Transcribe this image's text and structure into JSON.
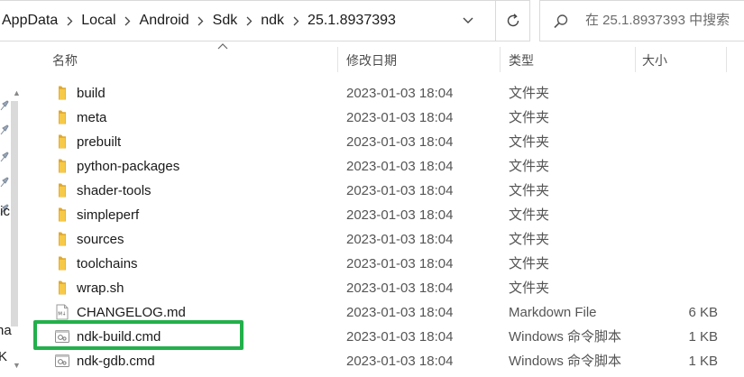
{
  "address": {
    "breadcrumb": [
      "AppData",
      "Local",
      "Android",
      "Sdk",
      "ndk",
      "25.1.8937393"
    ],
    "dropdown_icon": "chevron-down-icon",
    "refresh_icon": "refresh-icon"
  },
  "search": {
    "placeholder": "在 25.1.8937393 中搜索",
    "icon": "search-icon"
  },
  "nav": {
    "fragments": [
      "tic",
      "na",
      "K"
    ]
  },
  "columns": {
    "name": "名称",
    "date": "修改日期",
    "type": "类型",
    "size": "大小"
  },
  "files": [
    {
      "name": "build",
      "date": "2023-01-03 18:04",
      "type": "文件夹",
      "size": "",
      "icon": "folder-icon"
    },
    {
      "name": "meta",
      "date": "2023-01-03 18:04",
      "type": "文件夹",
      "size": "",
      "icon": "folder-icon"
    },
    {
      "name": "prebuilt",
      "date": "2023-01-03 18:04",
      "type": "文件夹",
      "size": "",
      "icon": "folder-icon"
    },
    {
      "name": "python-packages",
      "date": "2023-01-03 18:04",
      "type": "文件夹",
      "size": "",
      "icon": "folder-icon"
    },
    {
      "name": "shader-tools",
      "date": "2023-01-03 18:04",
      "type": "文件夹",
      "size": "",
      "icon": "folder-icon"
    },
    {
      "name": "simpleperf",
      "date": "2023-01-03 18:04",
      "type": "文件夹",
      "size": "",
      "icon": "folder-icon"
    },
    {
      "name": "sources",
      "date": "2023-01-03 18:04",
      "type": "文件夹",
      "size": "",
      "icon": "folder-icon"
    },
    {
      "name": "toolchains",
      "date": "2023-01-03 18:04",
      "type": "文件夹",
      "size": "",
      "icon": "folder-icon"
    },
    {
      "name": "wrap.sh",
      "date": "2023-01-03 18:04",
      "type": "文件夹",
      "size": "",
      "icon": "folder-icon"
    },
    {
      "name": "CHANGELOG.md",
      "date": "2023-01-03 18:04",
      "type": "Markdown File",
      "size": "6 KB",
      "icon": "markdown-file-icon"
    },
    {
      "name": "ndk-build.cmd",
      "date": "2023-01-03 18:04",
      "type": "Windows 命令脚本",
      "size": "1 KB",
      "icon": "cmd-script-icon"
    },
    {
      "name": "ndk-gdb.cmd",
      "date": "2023-01-03 18:04",
      "type": "Windows 命令脚本",
      "size": "1 KB",
      "icon": "cmd-script-icon"
    }
  ],
  "colors": {
    "highlight": "#22b04a",
    "folder": "#f7c948",
    "folder_dark": "#e0a82e"
  }
}
